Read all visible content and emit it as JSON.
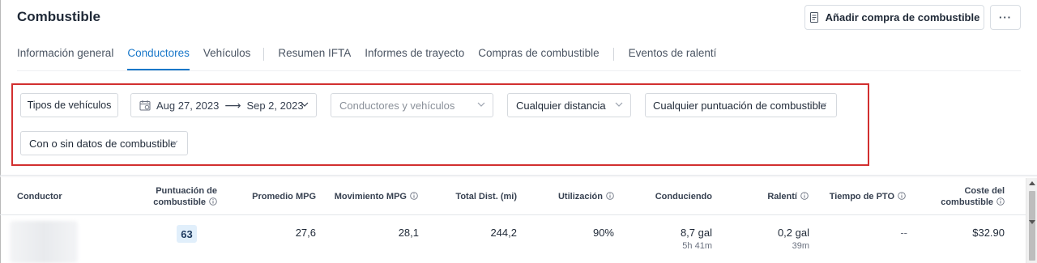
{
  "header": {
    "title": "Combustible",
    "add_purchase_label": "Añadir compra de combustible",
    "more_label": "···"
  },
  "tabs": [
    {
      "label": "Información general",
      "active": false
    },
    {
      "label": "Conductores",
      "active": true
    },
    {
      "label": "Vehículos",
      "active": false
    },
    {
      "label": "Resumen IFTA",
      "active": false
    },
    {
      "label": "Informes de trayecto",
      "active": false
    },
    {
      "label": "Compras de combustible",
      "active": false
    },
    {
      "label": "Eventos de ralentí",
      "active": false
    }
  ],
  "filters": {
    "vehicle_types": "Tipos de vehículos",
    "date_start": "Aug 27, 2023",
    "date_arrow": "⟶",
    "date_end": "Sep 2, 2023",
    "drivers_vehicles_placeholder": "Conductores y vehículos",
    "distance": "Cualquier distancia",
    "fuel_score": "Cualquier puntuación de combustible",
    "fuel_data": "Con o sin datos de combustible"
  },
  "table": {
    "columns": {
      "driver": "Conductor",
      "fuel_score_1": "Puntuación de",
      "fuel_score_2": "combustible",
      "avg_mpg": "Promedio MPG",
      "moving_mpg": "Movimiento MPG",
      "total_dist": "Total Dist. (mi)",
      "utilization": "Utilización",
      "driving": "Conduciendo",
      "idle": "Ralentí",
      "pto_time": "Tiempo de PTO",
      "fuel_cost_1": "Coste del",
      "fuel_cost_2": "combustible"
    },
    "rows": [
      {
        "fuel_score": "63",
        "avg_mpg": "27,6",
        "moving_mpg": "28,1",
        "total_dist": "244,2",
        "utilization": "90%",
        "driving_gal": "8,7 gal",
        "driving_time": "5h 41m",
        "idle_gal": "0,2 gal",
        "idle_time": "39m",
        "pto_time": "--",
        "fuel_cost": "$32.90"
      }
    ]
  },
  "colors": {
    "accent": "#1877c9",
    "highlight_border": "#d22f2f",
    "score_badge": "#e1effb"
  }
}
